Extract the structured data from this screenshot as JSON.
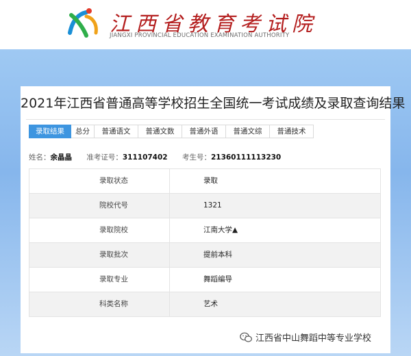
{
  "header": {
    "logo_title": "江西省教育考试院",
    "logo_subtitle": "JIANGXI PROVINCIAL EDUCATION EXAMINATION AUTHORITY",
    "logo_icon": "jx-logo-icon"
  },
  "page": {
    "title": "2021年江西省普通高等学校招生全国统一考试成绩及录取查询结果"
  },
  "tabs": [
    {
      "label": "录取结果",
      "active": true
    },
    {
      "label": "总分",
      "active": false
    },
    {
      "label": "普通语文",
      "active": false
    },
    {
      "label": "普通文数",
      "active": false
    },
    {
      "label": "普通外语",
      "active": false
    },
    {
      "label": "普通文综",
      "active": false
    },
    {
      "label": "普通技术",
      "active": false
    }
  ],
  "student": {
    "name_label": "姓名：",
    "name": "余晶晶",
    "exam_id_label": "准考证号：",
    "exam_id": "311107402",
    "candidate_no_label": "考生号：",
    "candidate_no": "21360111113230"
  },
  "result_rows": [
    {
      "key": "录取状态",
      "value": "录取"
    },
    {
      "key": "院校代号",
      "value": "1321"
    },
    {
      "key": "录取院校",
      "value": "江南大学▲"
    },
    {
      "key": "录取批次",
      "value": "提前本科"
    },
    {
      "key": "录取专业",
      "value": "舞蹈编导"
    },
    {
      "key": "科类名称",
      "value": "艺术"
    }
  ],
  "watermark": {
    "text": "江西省中山舞蹈中等专业学校",
    "icon": "wechat-icon"
  },
  "colors": {
    "accent": "#3d95e0",
    "logo_red": "#b41e1e",
    "band": "#86b6ec"
  }
}
